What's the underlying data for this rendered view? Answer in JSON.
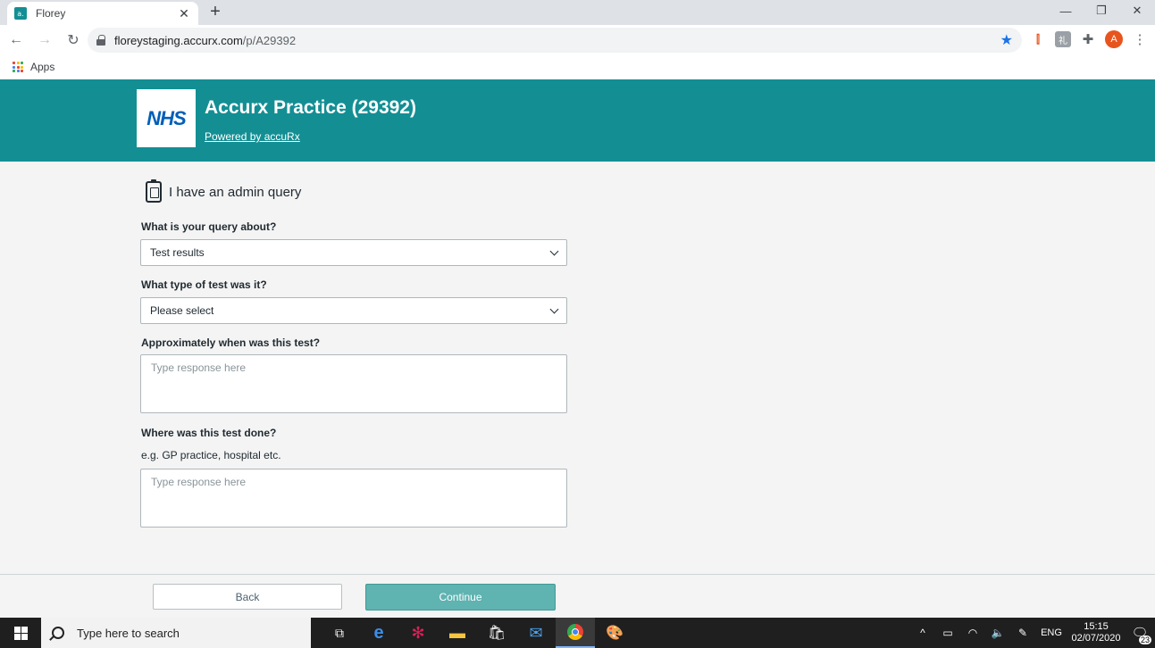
{
  "browser": {
    "tab_title": "Florey",
    "tab_favicon": "a.",
    "tab_close": "✕",
    "new_tab": "+",
    "url_host": "floreystaging.accurx.com",
    "url_path": "/p/A29392",
    "bookmarks_apps_label": "Apps",
    "profile_initial": "A",
    "window_controls": {
      "minimize": "—",
      "restore": "❐",
      "close": "✕"
    }
  },
  "header": {
    "logo_text": "NHS",
    "practice_title": "Accurx Practice (29392)",
    "powered_by": "Powered by accuRx"
  },
  "form": {
    "heading": "I have an admin query",
    "q1_label": "What is your query about?",
    "q1_value": "Test results",
    "q2_label": "What type of test was it?",
    "q2_value": "Please select",
    "q3_label": "Approximately when was this test?",
    "q3_placeholder": "Type response here",
    "q4_label": "Where was this test done?",
    "q4_hint": "e.g. GP practice, hospital etc.",
    "q4_placeholder": "Type response here"
  },
  "actions": {
    "back_label": "Back",
    "continue_label": "Continue"
  },
  "taskbar": {
    "search_placeholder": "Type here to search",
    "language": "ENG",
    "time": "15:15",
    "date": "02/07/2020",
    "notification_count": "23"
  },
  "colors": {
    "header_teal": "#138f94",
    "nhs_blue": "#005eb8",
    "continue_button": "#5fb3b1"
  }
}
